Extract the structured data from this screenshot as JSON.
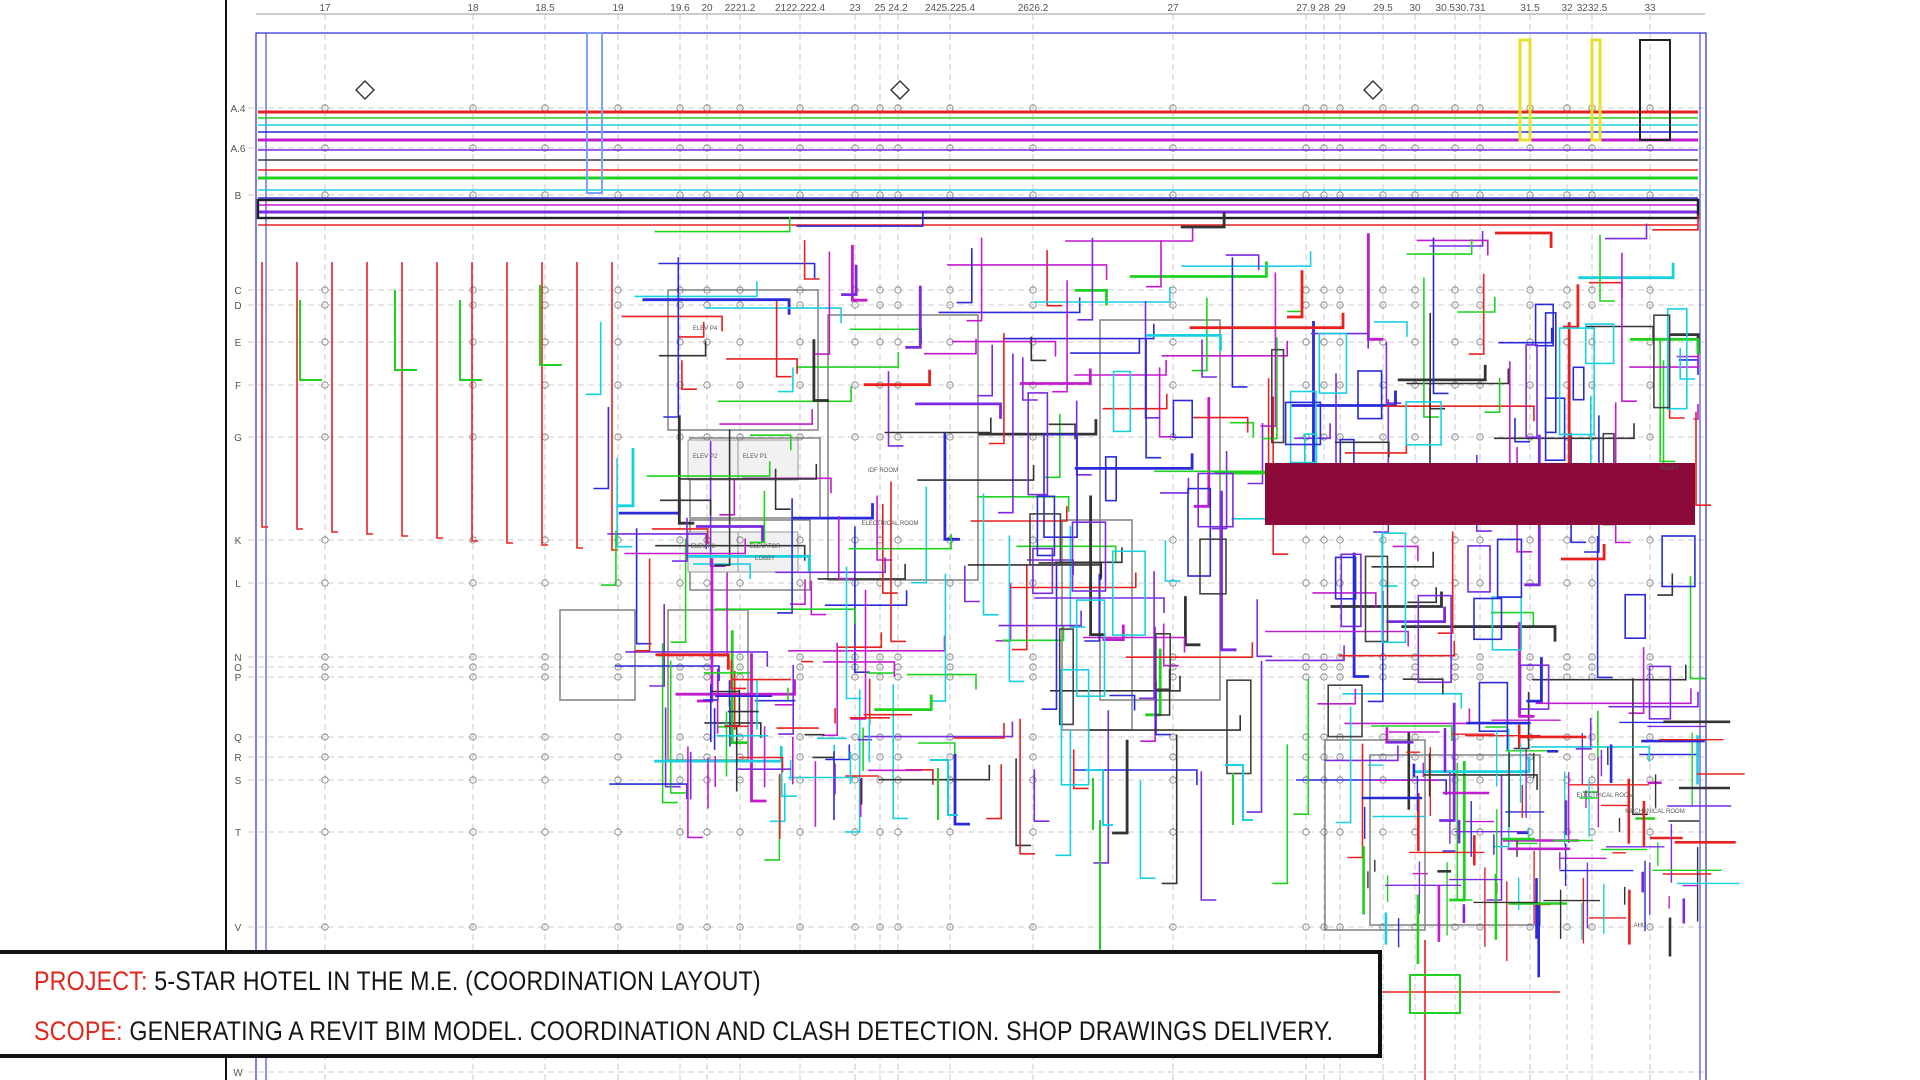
{
  "caption": {
    "project_label": "PROJECT:",
    "project_text": " 5-STAR HOTEL IN THE M.E. (COORDINATION LAYOUT)",
    "scope_label": "SCOPE:",
    "scope_text": " GENERATING A REVIT BIM MODEL. COORDINATION AND CLASH DETECTION. SHOP DRAWINGS DELIVERY."
  },
  "drawing": {
    "column_grid_labels": [
      "17",
      "18",
      "18.5",
      "19",
      "19.6",
      "20",
      "2221.2",
      "2122.222.4",
      "23",
      "25",
      "24.2",
      "2425.225.4",
      "2626.2",
      "27",
      "27.9",
      "28",
      "29",
      "29.5",
      "30",
      "30.530.7",
      "31",
      "31.5",
      "32",
      "3232.5",
      "33"
    ],
    "row_grid_labels": [
      "A.4",
      "A.6",
      "B",
      "C",
      "D",
      "E",
      "F",
      "G",
      "K",
      "L",
      "N",
      "O",
      "P",
      "Q",
      "R",
      "S",
      "T",
      "V",
      "W"
    ],
    "room_labels": [
      "ELEV P2",
      "ELEV P1",
      "ELEVATOR",
      "ELEV P3",
      "ELEV P4",
      "LOBBY",
      "ELECTRICAL ROOM",
      "IDF ROOM",
      "PLANT",
      "ELECTRICAL ROOM",
      "MECHANICAL ROOM",
      "AHU"
    ],
    "colors": {
      "highlight_band": "#8b0a3a",
      "pipe_red": "#e8201f",
      "pipe_green": "#1fd21f",
      "pipe_cyan": "#19d0e0",
      "pipe_blue": "#2a2ad8",
      "pipe_magenta": "#c21ccf",
      "pipe_purple": "#7a2be0",
      "pipe_yellow": "#e8e030",
      "dark_duct": "#333333",
      "grid_line": "#bdbdbd"
    }
  }
}
